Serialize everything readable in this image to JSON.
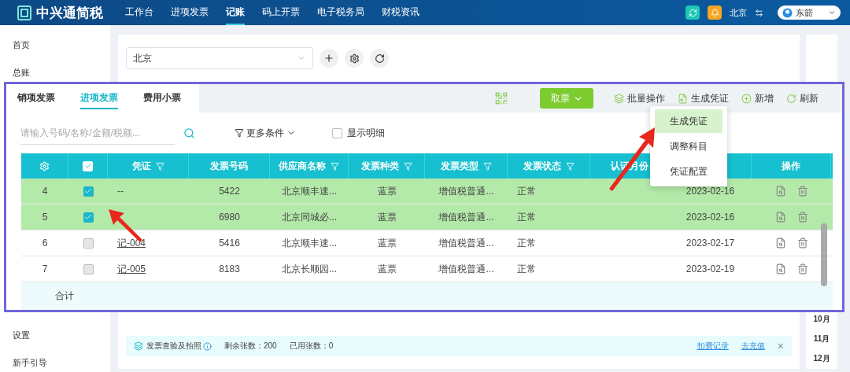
{
  "topbar": {
    "logo": "中兴通简税",
    "nav": [
      {
        "label": "工作台",
        "selected": false
      },
      {
        "label": "进项发票",
        "selected": false
      },
      {
        "label": "记账",
        "selected": true
      },
      {
        "label": "码上开票",
        "selected": false
      },
      {
        "label": "电子税务局",
        "selected": false
      },
      {
        "label": "财税资讯",
        "selected": false
      }
    ],
    "company": "北京",
    "user": "东箭"
  },
  "sidebar": {
    "top_items": [
      {
        "label": "首页"
      },
      {
        "label": "总账"
      }
    ],
    "bottom_items": [
      {
        "label": "设置"
      },
      {
        "label": "新手引导"
      }
    ]
  },
  "company_select": {
    "value": "北京"
  },
  "notice_bar": {
    "title": "发票查验及拍照",
    "remaining": "剩余张数：200",
    "used": "已用张数：0",
    "links": [
      "扣费记录",
      "去充值"
    ],
    "close": "×"
  },
  "months": [
    "10月",
    "11月",
    "12月"
  ],
  "panel": {
    "tabs": [
      {
        "label": "销项发票",
        "selected": false
      },
      {
        "label": "进项发票",
        "selected": true
      },
      {
        "label": "费用小票",
        "selected": false
      }
    ],
    "get_button": "取票",
    "actions": [
      "批量操作",
      "生成凭证",
      "新增",
      "刷新"
    ],
    "search": {
      "placeholder": "请输入号码/名称/金额/税额..."
    },
    "more_filter": "更多条件",
    "show_detail": {
      "label": "显示明细",
      "checked": false
    },
    "menu": [
      {
        "label": "生成凭证",
        "selected": true
      },
      {
        "label": "调整科目",
        "selected": false
      },
      {
        "label": "凭证配置",
        "selected": false
      }
    ],
    "table": {
      "columns": [
        {
          "kind": "settings"
        },
        {
          "kind": "check",
          "checked": true
        },
        {
          "kind": "text",
          "label": "凭证",
          "filter": true
        },
        {
          "kind": "text",
          "label": "发票号码",
          "filter": false
        },
        {
          "kind": "text",
          "label": "供应商名称",
          "filter": true
        },
        {
          "kind": "text",
          "label": "发票种类",
          "filter": true
        },
        {
          "kind": "text",
          "label": "发票类型",
          "filter": true
        },
        {
          "kind": "text",
          "label": "发票状态",
          "filter": true
        },
        {
          "kind": "text",
          "label": "认证月份",
          "filter": false
        },
        {
          "kind": "blank"
        },
        {
          "kind": "text",
          "label": "操作",
          "filter": false
        }
      ],
      "rows": [
        {
          "index": "4",
          "selected": true,
          "voucher": "--",
          "voucher_linked": false,
          "invoice_no": "5422",
          "supplier": "北京顺丰速...",
          "kind": "蓝票",
          "type": "增值税普通...",
          "status": "正常",
          "date": "2023-02-16"
        },
        {
          "index": "5",
          "selected": true,
          "invoice_no": "6980",
          "supplier": "北京同城必...",
          "kind": "蓝票",
          "type": "增值税普通...",
          "status": "正常",
          "date": "2023-02-16"
        },
        {
          "index": "6",
          "selected": false,
          "voucher": "记-004",
          "voucher_linked": true,
          "invoice_no": "5416",
          "supplier": "北京顺丰速...",
          "kind": "蓝票",
          "type": "增值税普通...",
          "status": "正常",
          "date": "2023-02-17"
        },
        {
          "index": "7",
          "selected": false,
          "voucher": "记-005",
          "voucher_linked": true,
          "invoice_no": "8183",
          "supplier": "北京长顺园...",
          "kind": "蓝票",
          "type": "增值税普通...",
          "status": "正常",
          "date": "2023-02-19"
        }
      ],
      "total": "合计"
    }
  }
}
